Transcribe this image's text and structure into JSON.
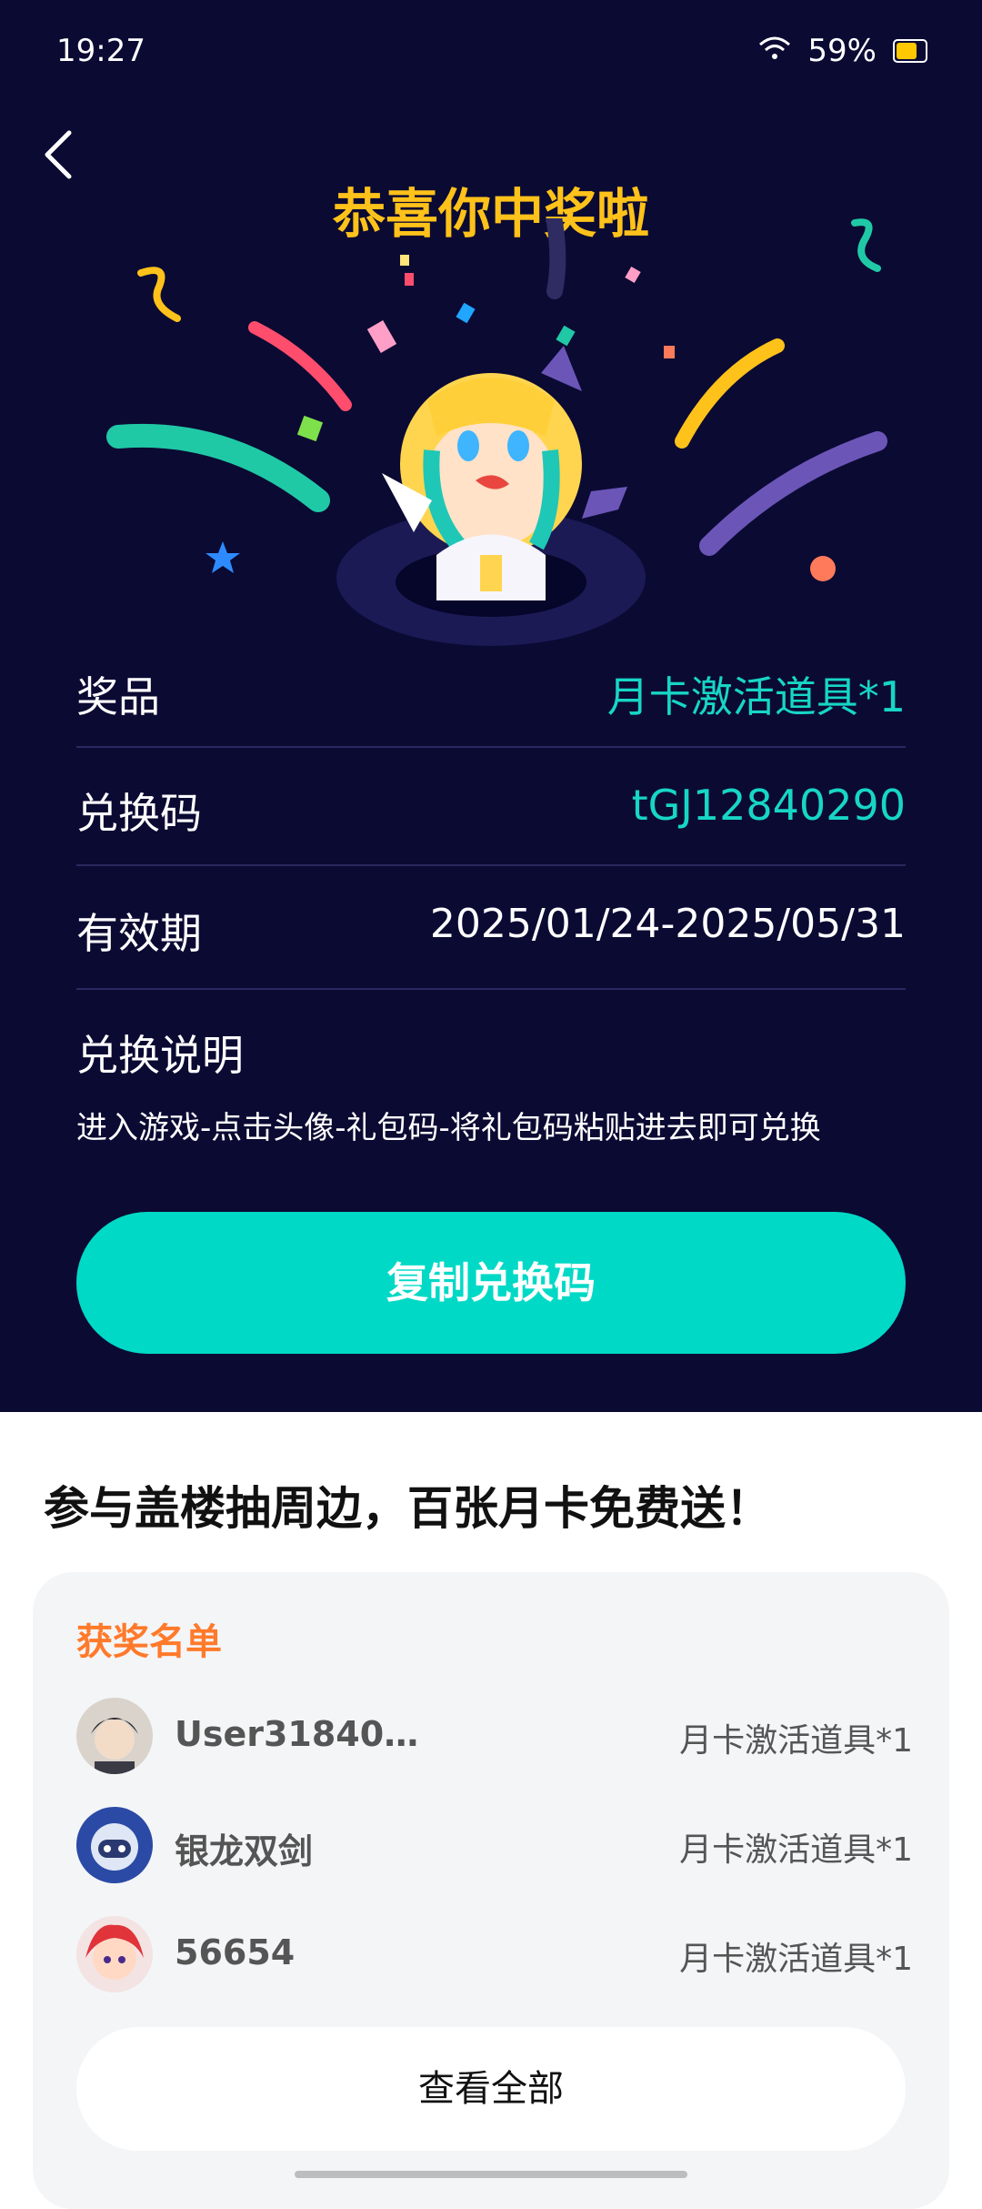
{
  "status": {
    "time": "19:27",
    "battery": "59%"
  },
  "header": {
    "title": "恭喜你中奖啦"
  },
  "prize": {
    "prize_label": "奖品",
    "prize_value": "月卡激活道具*1",
    "code_label": "兑换码",
    "code_value": "tGJ12840290",
    "validity_label": "有效期",
    "validity_value": "2025/01/24-2025/05/31",
    "instructions_label": "兑换说明",
    "instructions_text": "进入游戏-点击头像-礼包码-将礼包码粘贴进去即可兑换"
  },
  "actions": {
    "copy_button": "复制兑换码"
  },
  "promo": {
    "headline": "参与盖楼抽周边，百张月卡免费送！"
  },
  "winners": {
    "title": "获奖名单",
    "items": [
      {
        "name": "User31840…",
        "prize": "月卡激活道具*1"
      },
      {
        "name": "银龙双剑",
        "prize": "月卡激活道具*1"
      },
      {
        "name": "56654",
        "prize": "月卡激活道具*1"
      }
    ],
    "view_all": "查看全部"
  },
  "colors": {
    "background_top": "#0b0a33",
    "accent_teal": "#00d9c6",
    "title_gold": "#ffc21a",
    "winner_title_orange": "#ff7a2b"
  }
}
